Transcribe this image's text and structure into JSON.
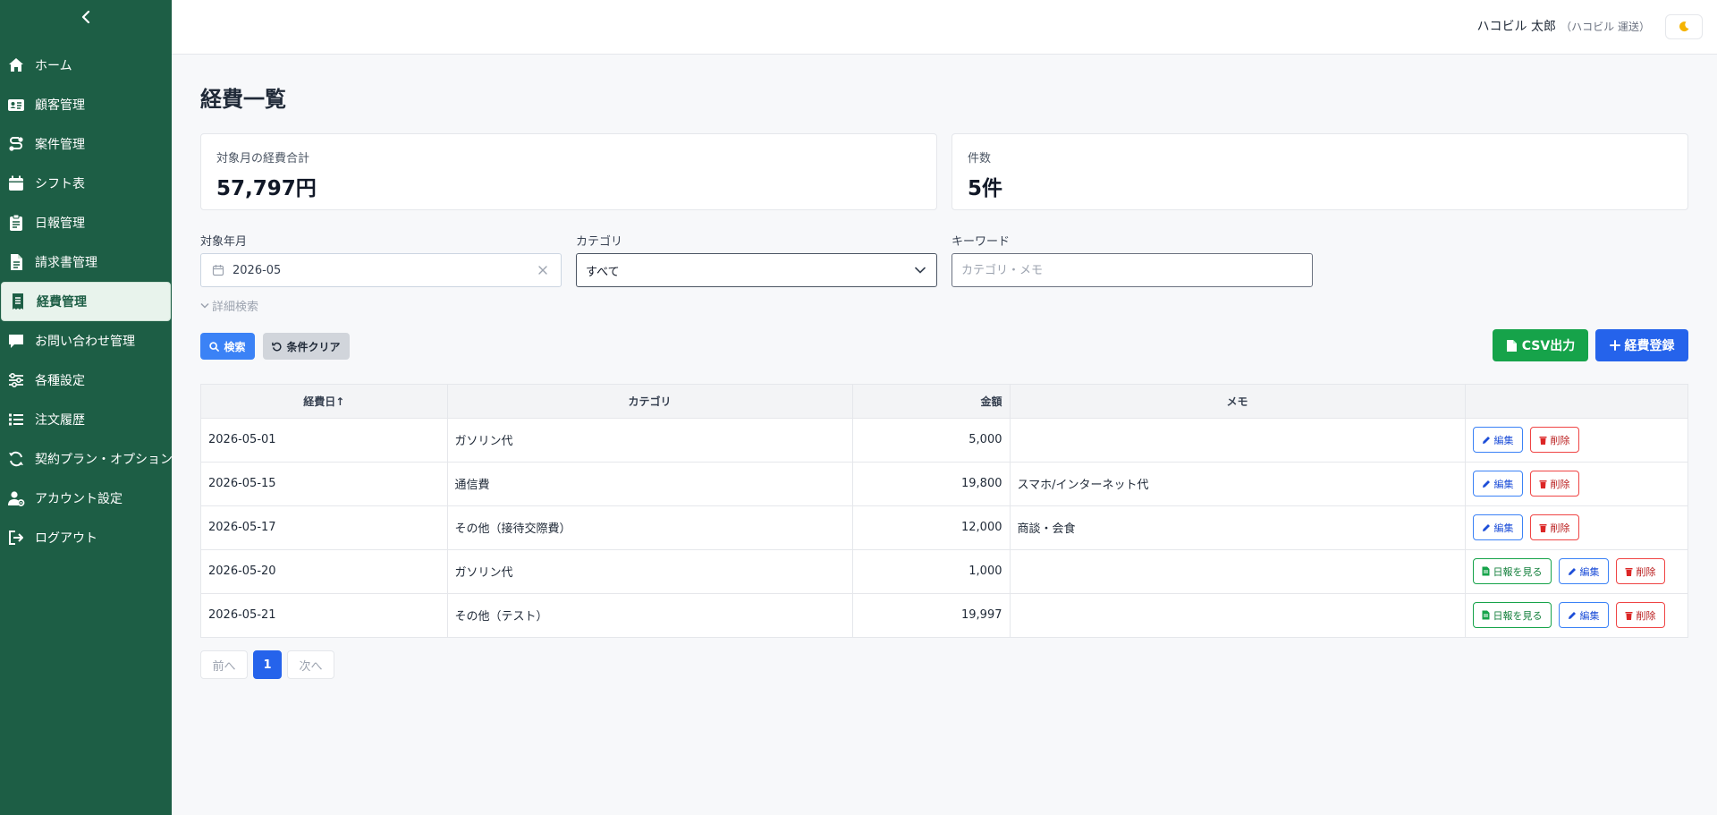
{
  "colors": {
    "sidebar": "#1d5e45",
    "primary": "#2563eb",
    "success": "#16a34a",
    "danger": "#ef4444"
  },
  "sidebar": {
    "items": [
      {
        "label": "ホーム",
        "icon": "home-icon"
      },
      {
        "label": "顧客管理",
        "icon": "id-card-icon"
      },
      {
        "label": "案件管理",
        "icon": "route-icon"
      },
      {
        "label": "シフト表",
        "icon": "calendar-icon"
      },
      {
        "label": "日報管理",
        "icon": "clipboard-icon"
      },
      {
        "label": "請求書管理",
        "icon": "file-icon"
      },
      {
        "label": "経費管理",
        "icon": "receipt-icon",
        "active": true
      },
      {
        "label": "お問い合わせ管理",
        "icon": "comment-icon"
      },
      {
        "label": "各種設定",
        "icon": "sliders-icon"
      },
      {
        "label": "注文履歴",
        "icon": "list-icon"
      },
      {
        "label": "契約プラン・オプション",
        "icon": "refresh-icon"
      },
      {
        "label": "アカウント設定",
        "icon": "user-gear-icon"
      },
      {
        "label": "ログアウト",
        "icon": "logout-icon"
      }
    ]
  },
  "header": {
    "user_name": "ハコビル 太郎",
    "company": "（ハコビル 運送）",
    "theme_icon": "moon-icon"
  },
  "page": {
    "title": "経費一覧"
  },
  "summary": {
    "total_label": "対象月の経費合計",
    "total_value": "57,797円",
    "count_label": "件数",
    "count_value": "5件"
  },
  "filters": {
    "month_label": "対象年月",
    "month_value": "2026-05",
    "category_label": "カテゴリ",
    "category_value": "すべて",
    "keyword_label": "キーワード",
    "keyword_placeholder": "カテゴリ・メモ",
    "advanced_label": "詳細検索"
  },
  "buttons": {
    "search": "検索",
    "clear": "条件クリア",
    "csv": "CSV出力",
    "add": "経費登録"
  },
  "table": {
    "headers": {
      "date": "経費日↑",
      "category": "カテゴリ",
      "amount": "金額",
      "memo": "メモ",
      "actions": ""
    },
    "action_labels": {
      "report": "日報を見る",
      "edit": "編集",
      "delete": "削除"
    },
    "rows": [
      {
        "date": "2026-05-01",
        "category": "ガソリン代",
        "amount": "5,000",
        "memo": "",
        "has_report": false
      },
      {
        "date": "2026-05-15",
        "category": "通信費",
        "amount": "19,800",
        "memo": "スマホ/インターネット代",
        "has_report": false
      },
      {
        "date": "2026-05-17",
        "category": "その他（接待交際費）",
        "amount": "12,000",
        "memo": "商談・会食",
        "has_report": false
      },
      {
        "date": "2026-05-20",
        "category": "ガソリン代",
        "amount": "1,000",
        "memo": "",
        "has_report": true
      },
      {
        "date": "2026-05-21",
        "category": "その他（テスト）",
        "amount": "19,997",
        "memo": "",
        "has_report": true
      }
    ]
  },
  "pagination": {
    "prev": "前へ",
    "current": "1",
    "next": "次へ"
  }
}
